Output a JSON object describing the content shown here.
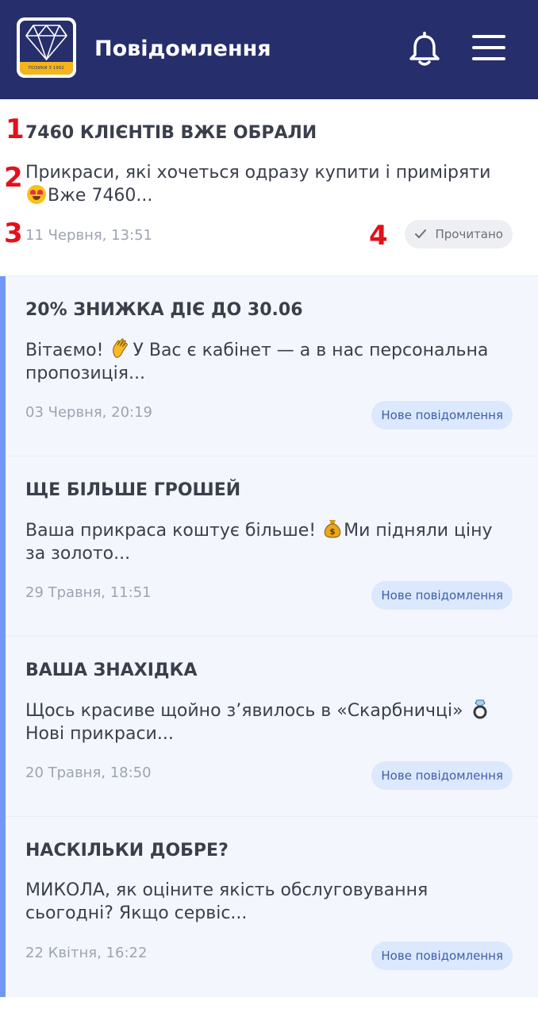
{
  "header": {
    "title": "Повідомлення",
    "logo_band_text": "ПОЗИКИ З 1992",
    "bell_icon": "bell-icon",
    "menu_icon": "hamburger-menu-icon",
    "background": "#262e6b"
  },
  "notifications": [
    {
      "title": "7460 КЛІЄНТІВ ВЖЕ ОБРАЛИ",
      "body_before": "Прикраси, які хочеться одразу купити і приміряти ",
      "emoji": "heart-eyes-emoji",
      "body_after": "Вже 7460...",
      "date": "11 Червня, 13:51",
      "status": "Прочитано",
      "read": true
    },
    {
      "title": "20% ЗНИЖКА ДІЄ ДО 30.06",
      "body_before": "Вітаємо! ",
      "emoji": "waving-hand-emoji",
      "body_after": "У Вас є кабінет — а в нас персональна пропозиція...",
      "date": "03 Червня, 20:19",
      "status": "Нове повідомлення",
      "read": false
    },
    {
      "title": "ЩЕ БІЛЬШЕ ГРОШЕЙ",
      "body_before": "Ваша прикраса коштує більше! ",
      "emoji": "money-bag-emoji",
      "body_after": "Ми підняли ціну за золото...",
      "date": "29 Травня, 11:51",
      "status": "Нове повідомлення",
      "read": false
    },
    {
      "title": "ВАША ЗНАХІДКА",
      "body_before": "Щось красиве щойно з’явилось в «Скарбничці» ",
      "emoji": "ring-emoji",
      "body_after": "Нові прикраси...",
      "date": "20 Травня, 18:50",
      "status": "Нове повідомлення",
      "read": false
    },
    {
      "title": "НАСКІЛЬКИ ДОБРЕ?",
      "body_before": "МИКОЛА, як оціните якість обслуговування сьогодні? Якщо сервіс...",
      "emoji": "",
      "body_after": "",
      "date": "22 Квітня, 16:22",
      "status": "Нове повідомлення",
      "read": false
    }
  ],
  "markers": [
    "1",
    "2",
    "3",
    "4"
  ],
  "colors": {
    "unread_background": "#f3f7fd",
    "unread_accent": "#7197f7",
    "badge_new_bg": "#dbe8fd",
    "badge_new_text": "#3f5ea8",
    "marker": "#e4101a"
  }
}
